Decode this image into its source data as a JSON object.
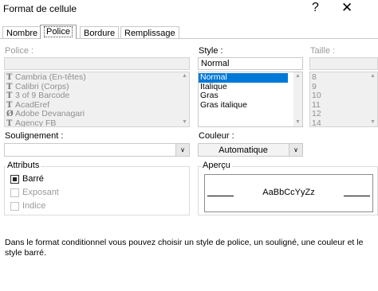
{
  "window": {
    "title": "Format de cellule",
    "help_glyph": "?",
    "close_glyph": "✕"
  },
  "tabs": [
    {
      "label": "Nombre"
    },
    {
      "label": "Police"
    },
    {
      "label": "Bordure"
    },
    {
      "label": "Remplissage"
    }
  ],
  "font": {
    "label": "Police :",
    "value": "",
    "items": [
      {
        "label": "Cambria (En-têtes)",
        "icon": "truetype-icon"
      },
      {
        "label": "Calibri (Corps)",
        "icon": "truetype-icon"
      },
      {
        "label": "3 of 9 Barcode",
        "icon": "truetype-icon"
      },
      {
        "label": "AcadEref",
        "icon": "truetype-icon"
      },
      {
        "label": "Adobe Devanagari",
        "icon": "opentype-icon"
      },
      {
        "label": "Agency FB",
        "icon": "truetype-icon"
      }
    ]
  },
  "style": {
    "label": "Style :",
    "value": "Normal",
    "items": [
      "Normal",
      "Italique",
      "Gras",
      "Gras italique"
    ],
    "selected": "Normal"
  },
  "size": {
    "label": "Taille :",
    "value": "",
    "items": [
      "8",
      "9",
      "10",
      "11",
      "12",
      "14"
    ]
  },
  "underline": {
    "label": "Soulignement :",
    "value": ""
  },
  "color": {
    "label": "Couleur :",
    "value": "Automatique"
  },
  "attributes": {
    "label": "Attributs",
    "strikethrough": "Barré",
    "superscript": "Exposant",
    "subscript": "Indice"
  },
  "preview": {
    "label": "Aperçu",
    "sample": "AaBbCcYyZz"
  },
  "description": "Dans le format conditionnel vous pouvez choisir un style de police, un souligné, une couleur et le style barré.",
  "colors": {
    "selection": "#0078d7",
    "disabled_text": "#9a9a9a"
  }
}
